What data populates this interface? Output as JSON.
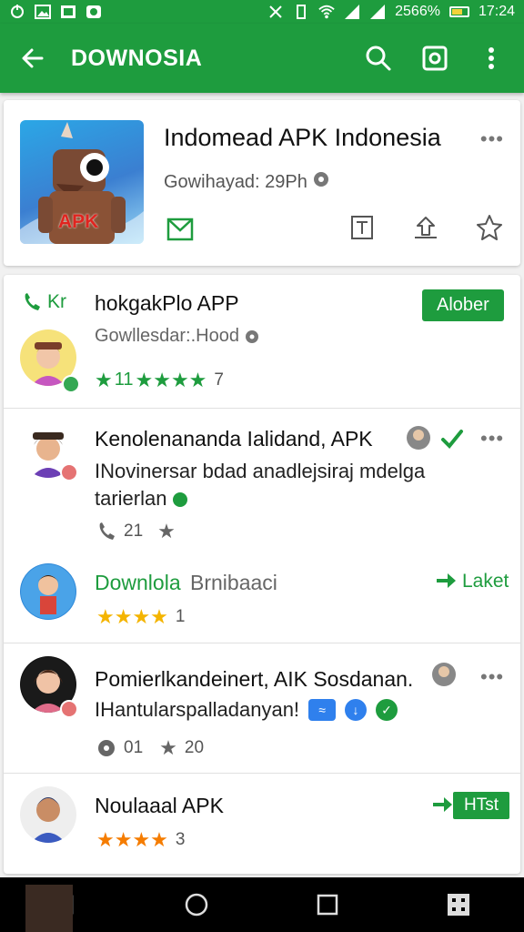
{
  "status_bar": {
    "percent": "2566%",
    "time": "17:24",
    "icons": [
      "sync-icon",
      "image-icon",
      "keyboard-icon",
      "camera-icon",
      "mute-icon",
      "vibrate-icon",
      "wifi-icon",
      "signal-icon",
      "signal-icon",
      "battery-icon"
    ]
  },
  "toolbar": {
    "title": "DOWNOSIA",
    "icons": [
      "back-arrow-icon",
      "search-icon",
      "screenshot-icon",
      "more-vert-icon"
    ]
  },
  "hero": {
    "title": "Indomead APK Indonesia",
    "subtitle": "Gowihayad: 29Ph",
    "icon_label": "APK",
    "more": "•••",
    "actions": [
      "mail-icon",
      "text-icon",
      "share-icon",
      "star-icon"
    ]
  },
  "items": [
    {
      "tag": "Kr",
      "title": "hokgakPlo APP",
      "subtitle": "Gowllesdar:.Hood",
      "button": "Alober",
      "stars": "★★★★",
      "stars_prefix": "11",
      "count": "7",
      "star_color": "#1e9c3e"
    },
    {
      "title": "Kenolenananda Ialidand, APK",
      "description": "INovinersar bdad anadlejsiraj mdelga tarierlan",
      "count": "21",
      "more": "•••"
    },
    {
      "title": "Downlola",
      "title_suffix": "Brnibaaci",
      "link": "Laket",
      "stars": "★★★★",
      "count": "1",
      "star_color": "#f4b400"
    },
    {
      "title": "Pomierlkandeinert, AIK Sosdanan.",
      "description": "IHantularspalladanyan!",
      "count_a": "01",
      "count_b": "20",
      "more": "•••"
    },
    {
      "title": "Noulaaal APK",
      "button": "HTst",
      "stars": "★★★★",
      "count": "3",
      "star_color": "#f57c00"
    }
  ],
  "nav": [
    "back-icon",
    "home-icon",
    "recents-icon",
    "grid-icon"
  ]
}
